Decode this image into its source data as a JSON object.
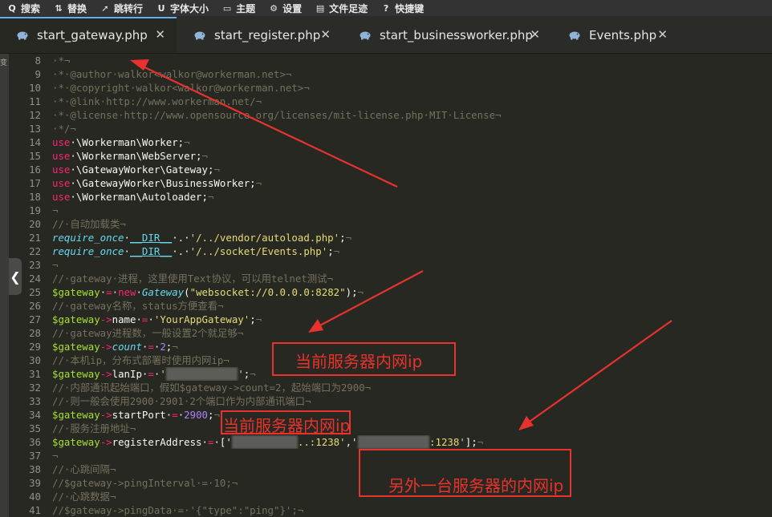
{
  "toolbar": [
    {
      "icon": "search-icon",
      "glyph": "Q",
      "label": "搜索"
    },
    {
      "icon": "replace-icon",
      "glyph": "⇅",
      "label": "替换"
    },
    {
      "icon": "goto-line-icon",
      "glyph": "➚",
      "label": "跳转行"
    },
    {
      "icon": "font-size-icon",
      "glyph": "U",
      "label": "字体大小"
    },
    {
      "icon": "theme-icon",
      "glyph": "▭",
      "label": "主题"
    },
    {
      "icon": "settings-gear-icon",
      "glyph": "⚙",
      "label": "设置"
    },
    {
      "icon": "file-history-icon",
      "glyph": "▤",
      "label": "文件足迹"
    },
    {
      "icon": "shortcut-help-icon",
      "glyph": "?",
      "label": "快捷键"
    }
  ],
  "tabs": [
    {
      "label": "start_gateway.php",
      "active": true
    },
    {
      "label": "start_register.php",
      "active": false
    },
    {
      "label": "start_businessworker.php",
      "active": false
    },
    {
      "label": "Events.php",
      "active": false
    }
  ],
  "close_glyph": "✕",
  "collapse_glyph": "❮",
  "side_mark": "变",
  "code": {
    "first_line": 8,
    "lines": [
      [
        [
          "c-cm",
          "·*¬"
        ]
      ],
      [
        [
          "c-cm",
          "·*·@author·walkor<walkor@workerman.net>¬"
        ]
      ],
      [
        [
          "c-cm",
          "·*·@copyright·walkor<walkor@workerman.net>¬"
        ]
      ],
      [
        [
          "c-cm",
          "·*·@link·http://www.workerman.net/¬"
        ]
      ],
      [
        [
          "c-cm",
          "·*·@license·http://www.opensource.org/licenses/mit-license.php·MIT·License¬"
        ]
      ],
      [
        [
          "c-cm",
          "·*/¬"
        ]
      ],
      [
        [
          "c-kw",
          "use"
        ],
        [
          "",
          "·\\Workerman\\Worker;"
        ],
        [
          "c-cm",
          "¬"
        ]
      ],
      [
        [
          "c-kw",
          "use"
        ],
        [
          "",
          "·\\Workerman\\WebServer;"
        ],
        [
          "c-cm",
          "¬"
        ]
      ],
      [
        [
          "c-kw",
          "use"
        ],
        [
          "",
          "·\\GatewayWorker\\Gateway;"
        ],
        [
          "c-cm",
          "¬"
        ]
      ],
      [
        [
          "c-kw",
          "use"
        ],
        [
          "",
          "·\\GatewayWorker\\BusinessWorker;"
        ],
        [
          "c-cm",
          "¬"
        ]
      ],
      [
        [
          "c-kw",
          "use"
        ],
        [
          "",
          "·\\Workerman\\Autoloader;"
        ],
        [
          "c-cm",
          "¬"
        ]
      ],
      [
        [
          "c-cm",
          "¬"
        ]
      ],
      [
        [
          "c-cm",
          "//·自动加载类¬"
        ]
      ],
      [
        [
          "c-cls",
          "require_once"
        ],
        [
          "",
          "·"
        ],
        [
          "c-const",
          "__DIR__"
        ],
        [
          "",
          "·.·"
        ],
        [
          "c-str",
          "'/../vendor/autoload.php'"
        ],
        [
          "",
          ";"
        ],
        [
          "c-cm",
          "¬"
        ]
      ],
      [
        [
          "c-cls",
          "require_once"
        ],
        [
          "",
          "·"
        ],
        [
          "c-const",
          "__DIR__"
        ],
        [
          "",
          "·.·"
        ],
        [
          "c-str",
          "'/../socket/Events.php'"
        ],
        [
          "",
          ";"
        ],
        [
          "c-cm",
          "¬"
        ]
      ],
      [
        [
          "c-cm",
          "¬"
        ]
      ],
      [
        [
          "c-cm",
          "//·gateway·进程，这里使用Text协议，可以用telnet测试¬"
        ]
      ],
      [
        [
          "c-var",
          "$gateway"
        ],
        [
          "",
          "·"
        ],
        [
          "c-kw",
          "="
        ],
        [
          "",
          "·"
        ],
        [
          "c-kw",
          "new"
        ],
        [
          "",
          "·"
        ],
        [
          "c-cls",
          "Gateway"
        ],
        [
          "",
          "("
        ],
        [
          "c-str",
          "\"websocket://0.0.0.0:8282\""
        ],
        [
          "",
          ");"
        ],
        [
          "c-cm",
          "¬"
        ]
      ],
      [
        [
          "c-cm",
          "//·gateway名称，status方便查看¬"
        ]
      ],
      [
        [
          "c-var",
          "$gateway"
        ],
        [
          "c-kw",
          "->"
        ],
        [
          "",
          "name·"
        ],
        [
          "c-kw",
          "="
        ],
        [
          "",
          "·"
        ],
        [
          "c-str",
          "'YourAppGateway'"
        ],
        [
          "",
          ";"
        ],
        [
          "c-cm",
          "¬"
        ]
      ],
      [
        [
          "c-cm",
          "//·gateway进程数，一般设置2个就足够¬"
        ]
      ],
      [
        [
          "c-var",
          "$gateway"
        ],
        [
          "c-kw",
          "->"
        ],
        [
          "c-cls",
          "count"
        ],
        [
          "",
          "·"
        ],
        [
          "c-kw",
          "="
        ],
        [
          "",
          "·"
        ],
        [
          "c-num",
          "2"
        ],
        [
          "",
          ";"
        ],
        [
          "c-cm",
          "¬"
        ]
      ],
      [
        [
          "c-cm",
          "//·本机ip，分布式部署时使用内网ip¬"
        ]
      ],
      [
        [
          "c-var",
          "$gateway"
        ],
        [
          "c-kw",
          "->"
        ],
        [
          "",
          "lanIp·"
        ],
        [
          "c-kw",
          "="
        ],
        [
          "",
          "·"
        ],
        [
          "c-str",
          "'"
        ],
        [
          "blur",
          "172.16.0.101"
        ],
        [
          "c-str",
          "'"
        ],
        [
          "",
          ";"
        ],
        [
          "c-cm",
          "¬"
        ]
      ],
      [
        [
          "c-cm",
          "//·内部通讯起始端口，假如$gateway->count=2，起始端口为2900¬"
        ]
      ],
      [
        [
          "c-cm",
          "//·则一般会使用2900·2901·2个端口作为内部通讯端口¬"
        ]
      ],
      [
        [
          "c-var",
          "$gateway"
        ],
        [
          "c-kw",
          "->"
        ],
        [
          "",
          "startPort·"
        ],
        [
          "c-kw",
          "="
        ],
        [
          "",
          "·"
        ],
        [
          "c-num",
          "2900"
        ],
        [
          "",
          ";"
        ],
        [
          "c-cm",
          "¬"
        ]
      ],
      [
        [
          "c-cm",
          "//·服务注册地址¬"
        ]
      ],
      [
        [
          "c-var",
          "$gateway"
        ],
        [
          "c-kw",
          "->"
        ],
        [
          "",
          "registerAddress·"
        ],
        [
          "c-kw",
          "="
        ],
        [
          "",
          "·['"
        ],
        [
          "blur",
          "172.16.0.10"
        ],
        [
          "c-str",
          "..:1238'"
        ],
        [
          "",
          ",'"
        ],
        [
          "blur",
          "172.16.0.102"
        ],
        [
          "c-str",
          ":1238'"
        ],
        [
          "",
          "];"
        ],
        [
          "c-cm",
          "¬"
        ]
      ],
      [
        [
          "c-cm",
          "¬"
        ]
      ],
      [
        [
          "c-cm",
          "//·心跳间隔¬"
        ]
      ],
      [
        [
          "c-cm",
          "//$gateway->pingInterval·=·10;¬"
        ]
      ],
      [
        [
          "c-cm",
          "//·心跳数据¬"
        ]
      ],
      [
        [
          "c-cm",
          "//$gateway->pingData·=·'{\"type\":\"ping\"}';¬"
        ]
      ]
    ]
  },
  "annotations": {
    "label1": "当前服务器内网ip",
    "label2": "当前服务器内网ip",
    "label3": "另外一台服务器的内网ip",
    "color": "#e8322d"
  }
}
